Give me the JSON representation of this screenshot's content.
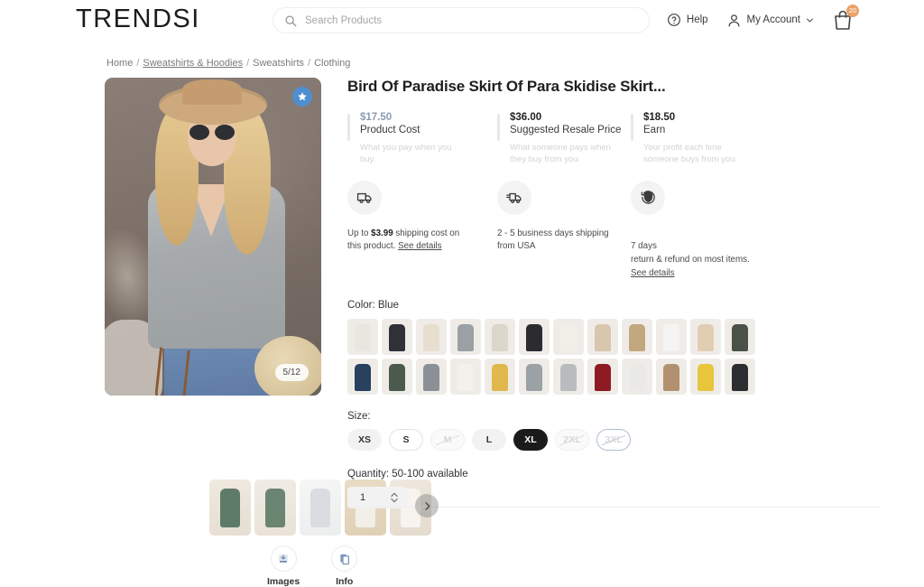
{
  "header": {
    "logo": "TRENDSI",
    "search": {
      "placeholder": "Search Products",
      "value": "",
      "icon": "search-icon"
    },
    "help": {
      "label": "Help",
      "icon": "question-circle-icon"
    },
    "account": {
      "label": "My Account",
      "icon": "user-icon",
      "chevron": "chevron-down-icon"
    },
    "cart": {
      "icon": "shopping-bag-icon",
      "badge": "20",
      "badge_color": "#e9a16b"
    }
  },
  "breadcrumb": {
    "items": [
      {
        "label": "Home",
        "underline": false
      },
      {
        "label": "Sweatshirts & Hoodies",
        "underline": true
      },
      {
        "label": "Sweatshirts",
        "underline": false
      },
      {
        "label": "Clothing",
        "underline": false
      }
    ],
    "separator": "/"
  },
  "gallery": {
    "counter": "5/12",
    "favorite_icon": "star-icon",
    "favorite_color": "#4f8fd0",
    "next_icon": "chevron-right-icon",
    "thumbnail_count": 5,
    "actions": [
      {
        "label": "Images",
        "icon": "download-images-icon"
      },
      {
        "label": "Info",
        "icon": "copy-info-icon"
      }
    ]
  },
  "product": {
    "title": "Bird Of Paradise Skirt Of Para Skidise Skirt...",
    "prices": [
      {
        "value": "$17.50",
        "label": "Product Cost",
        "note": "What you pay when you buy.",
        "tone": "cost"
      },
      {
        "value": "$36.00",
        "label": "Suggested Resale Price",
        "note": "What someone pays when they buy from you.",
        "tone": "dark"
      },
      {
        "value": "$18.50",
        "label": "Earn",
        "note": "Your profit each time someone buys from you.",
        "tone": "dark"
      }
    ],
    "shipping": [
      {
        "icon": "truck-icon",
        "text_pre": "Up to ",
        "text_bold": "$3.99",
        "text_post": " shipping cost on this product. ",
        "link": "See details"
      },
      {
        "icon": "fast-truck-icon",
        "text_pre": "2 - 5 business days shipping from USA",
        "text_bold": "",
        "text_post": "",
        "link": ""
      },
      {
        "icon": "shield-return-icon",
        "text_pre": "7 days\nreturn & refund on most items. ",
        "text_bold": "",
        "text_post": "",
        "link": "See details"
      }
    ],
    "color": {
      "label": "Color: Blue",
      "selected": "Blue",
      "swatches": [
        "#e9e6e0",
        "#2f3136",
        "#e8ded0",
        "#9aa0a3",
        "#dcd6cb",
        "#2b2c30",
        "#f2efe9",
        "#d9c6ae",
        "#c2a77f",
        "#f4f4f2",
        "#e0cdb2",
        "#4b5147",
        "#27415e",
        "#4c5a4e",
        "#8a9095",
        "#f3f1ec",
        "#e0b84c",
        "#9aa2a6",
        "#b9bcbe",
        "#8e1b24",
        "#e9e9e7",
        "#b19170",
        "#e8c53a",
        "#2b2d31"
      ]
    },
    "size": {
      "label": "Size:",
      "options": [
        {
          "label": "XS",
          "state": "available"
        },
        {
          "label": "S",
          "state": "outline"
        },
        {
          "label": "M",
          "state": "disabled"
        },
        {
          "label": "L",
          "state": "available"
        },
        {
          "label": "XL",
          "state": "selected"
        },
        {
          "label": "2XL",
          "state": "disabled"
        },
        {
          "label": "3XL",
          "state": "disabled-blue"
        }
      ]
    },
    "quantity": {
      "label": "Quantity: 50-100 available",
      "value": "1",
      "stepper_icon": "stepper-up-down-icon"
    }
  }
}
